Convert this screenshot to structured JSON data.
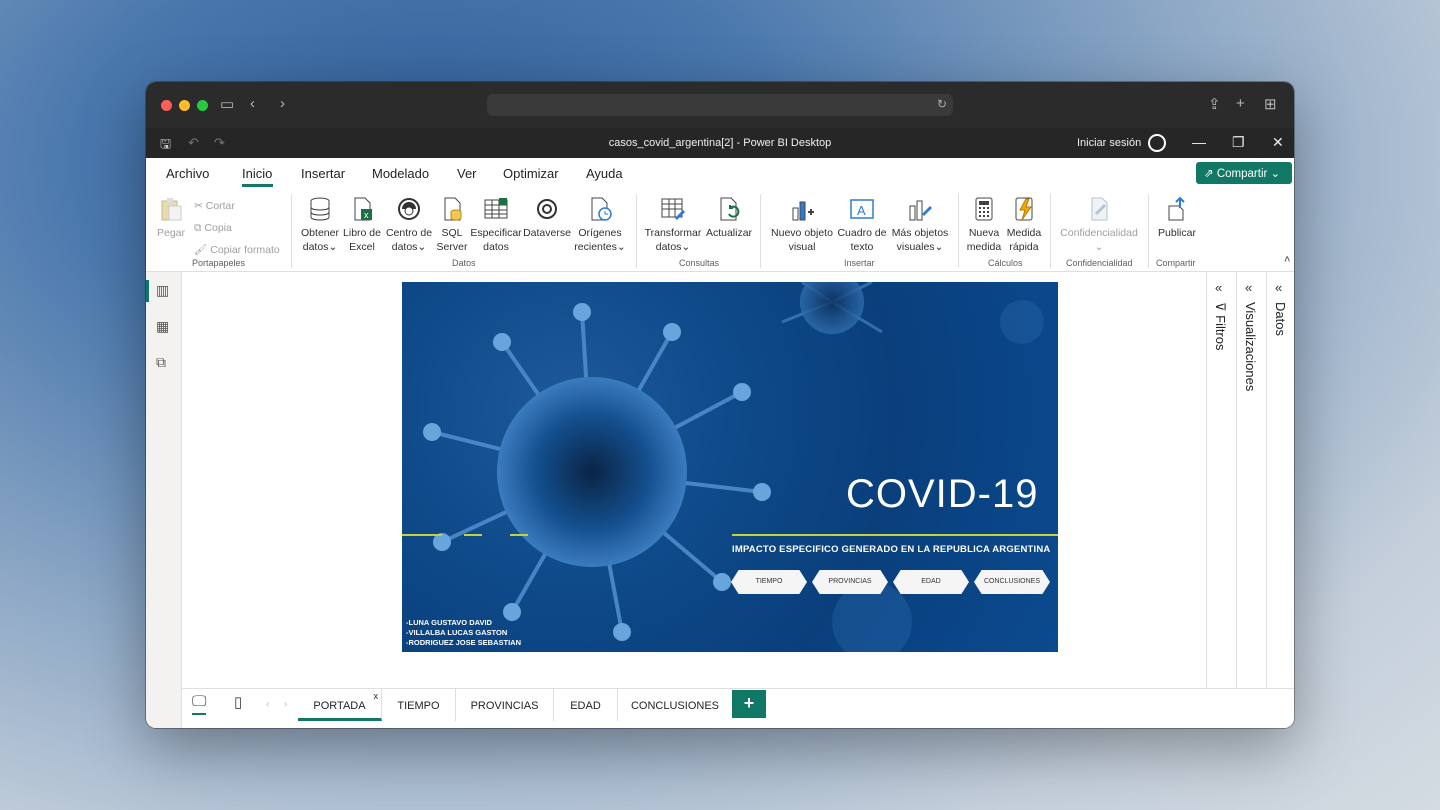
{
  "browser": {
    "dot_colors": [
      "#fe5f57",
      "#febc2e",
      "#28c840"
    ]
  },
  "titlebar": {
    "title": "casos_covid_argentina[2] - Power BI Desktop",
    "signin": "Iniciar sesión"
  },
  "menu": {
    "tabs": [
      "Archivo",
      "Inicio",
      "Insertar",
      "Modelado",
      "Ver",
      "Optimizar",
      "Ayuda"
    ],
    "share": "Compartir"
  },
  "ribbon": {
    "clipboard": {
      "paste": "Pegar",
      "cut": "Cortar",
      "copy": "Copia",
      "format": "Copiar formato",
      "group": "Portapapeles"
    },
    "data": {
      "get_data_1": "Obtener",
      "get_data_2": "datos",
      "excel_1": "Libro de",
      "excel_2": "Excel",
      "hub_1": "Centro de",
      "hub_2": "datos",
      "sql_1": "SQL",
      "sql_2": "Server",
      "enter_1": "Especificar",
      "enter_2": "datos",
      "dataverse": "Dataverse",
      "recent_1": "Orígenes",
      "recent_2": "recientes",
      "group": "Datos"
    },
    "queries": {
      "transform_1": "Transformar",
      "transform_2": "datos",
      "refresh": "Actualizar",
      "group": "Consultas"
    },
    "insert": {
      "visual_1": "Nuevo objeto",
      "visual_2": "visual",
      "textbox_1": "Cuadro de",
      "textbox_2": "texto",
      "more_1": "Más objetos",
      "more_2": "visuales",
      "group": "Insertar"
    },
    "calcs": {
      "measure_1": "Nueva",
      "measure_2": "medida",
      "quick_1": "Medida",
      "quick_2": "rápida",
      "group": "Cálculos"
    },
    "sensitivity": {
      "label": "Confidencialidad",
      "group": "Confidencialidad"
    },
    "share": {
      "publish": "Publicar",
      "group": "Compartir"
    }
  },
  "panes": {
    "filters": "Filtros",
    "visualizations": "Visualizaciones",
    "data": "Datos"
  },
  "slide": {
    "title": "COVID-19",
    "subtitle": "IMPACTO ESPECIFICO GENERADO EN LA REPUBLICA ARGENTINA",
    "buttons": [
      "TIEMPO",
      "PROVINCIAS",
      "EDAD",
      "CONCLUSIONES"
    ],
    "authors": [
      "-LUNA GUSTAVO DAVID",
      "-VILLALBA LUCAS GASTON",
      "-RODRIGUEZ JOSE SEBASTIAN"
    ]
  },
  "pages": {
    "tabs": [
      "PORTADA",
      "TIEMPO",
      "PROVINCIAS",
      "EDAD",
      "CONCLUSIONES"
    ],
    "close_glyph": "x",
    "add_glyph": "+"
  },
  "colors": {
    "accent": "#117865",
    "slide_bg": "#0b4a8f",
    "highlight_line": "#c6d23a"
  }
}
